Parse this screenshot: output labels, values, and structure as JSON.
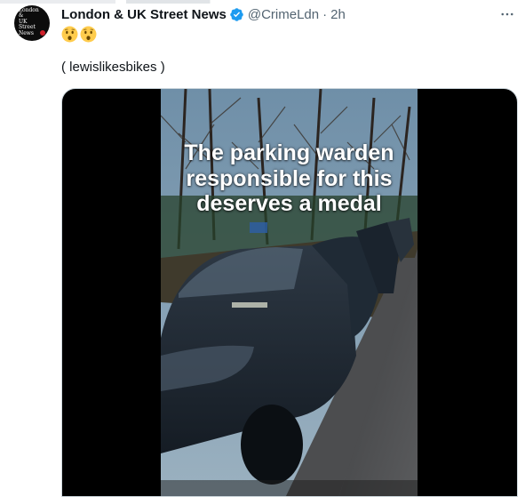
{
  "post": {
    "author_name": "London & UK Street News",
    "handle": "@CrimeLdn",
    "separator": "·",
    "time": "2h",
    "emoji_line": "😯😯",
    "text": "( lewislikesbikes )",
    "avatar_logo_lines": [
      "London &",
      "UK Street",
      "News"
    ],
    "verified": true
  },
  "video": {
    "caption_lines": [
      "The parking warden",
      "responsible for this",
      "deserves a medal"
    ]
  },
  "icons": {
    "more": "more-horizontal-icon",
    "verified": "verified-badge-icon",
    "emoji": "hushed-face-emoji"
  },
  "colors": {
    "verified_blue": "#1d9bf0",
    "secondary_text": "#536471",
    "primary_text": "#0f1419"
  }
}
